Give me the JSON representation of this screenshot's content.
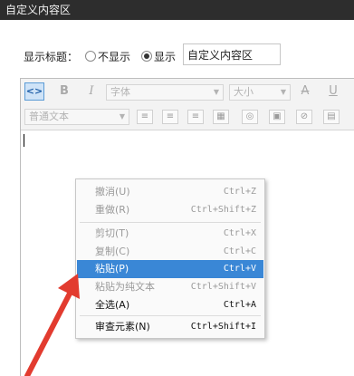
{
  "window": {
    "title": "自定义内容区"
  },
  "form": {
    "display_title_label": "显示标题：",
    "radio_hide_label": "不显示",
    "radio_show_label": "显示",
    "title_value": "自定义内容区"
  },
  "toolbar": {
    "source_label": "<>",
    "bold": "B",
    "italic": "I",
    "font_family_value": "字体",
    "font_size_value": "大小",
    "strike": "A",
    "underline": "U",
    "paragraph_value": "普通文本"
  },
  "context_menu": {
    "items": [
      {
        "label": "撤消(U)",
        "shortcut": "Ctrl+Z",
        "state": "disabled"
      },
      {
        "label": "重做(R)",
        "shortcut": "Ctrl+Shift+Z",
        "state": "disabled"
      },
      {
        "label": "剪切(T)",
        "shortcut": "Ctrl+X",
        "state": "disabled"
      },
      {
        "label": "复制(C)",
        "shortcut": "Ctrl+C",
        "state": "disabled"
      },
      {
        "label": "粘贴(P)",
        "shortcut": "Ctrl+V",
        "state": "highlighted"
      },
      {
        "label": "粘贴为纯文本",
        "shortcut": "Ctrl+Shift+V",
        "state": "disabled"
      },
      {
        "label": "全选(A)",
        "shortcut": "Ctrl+A",
        "state": "enabled"
      },
      {
        "label": "审查元素(N)",
        "shortcut": "Ctrl+Shift+I",
        "state": "enabled"
      }
    ]
  },
  "colors": {
    "highlight": "#3a87d6",
    "titlebar": "#2d2d2d",
    "arrow": "#e23b2f"
  }
}
